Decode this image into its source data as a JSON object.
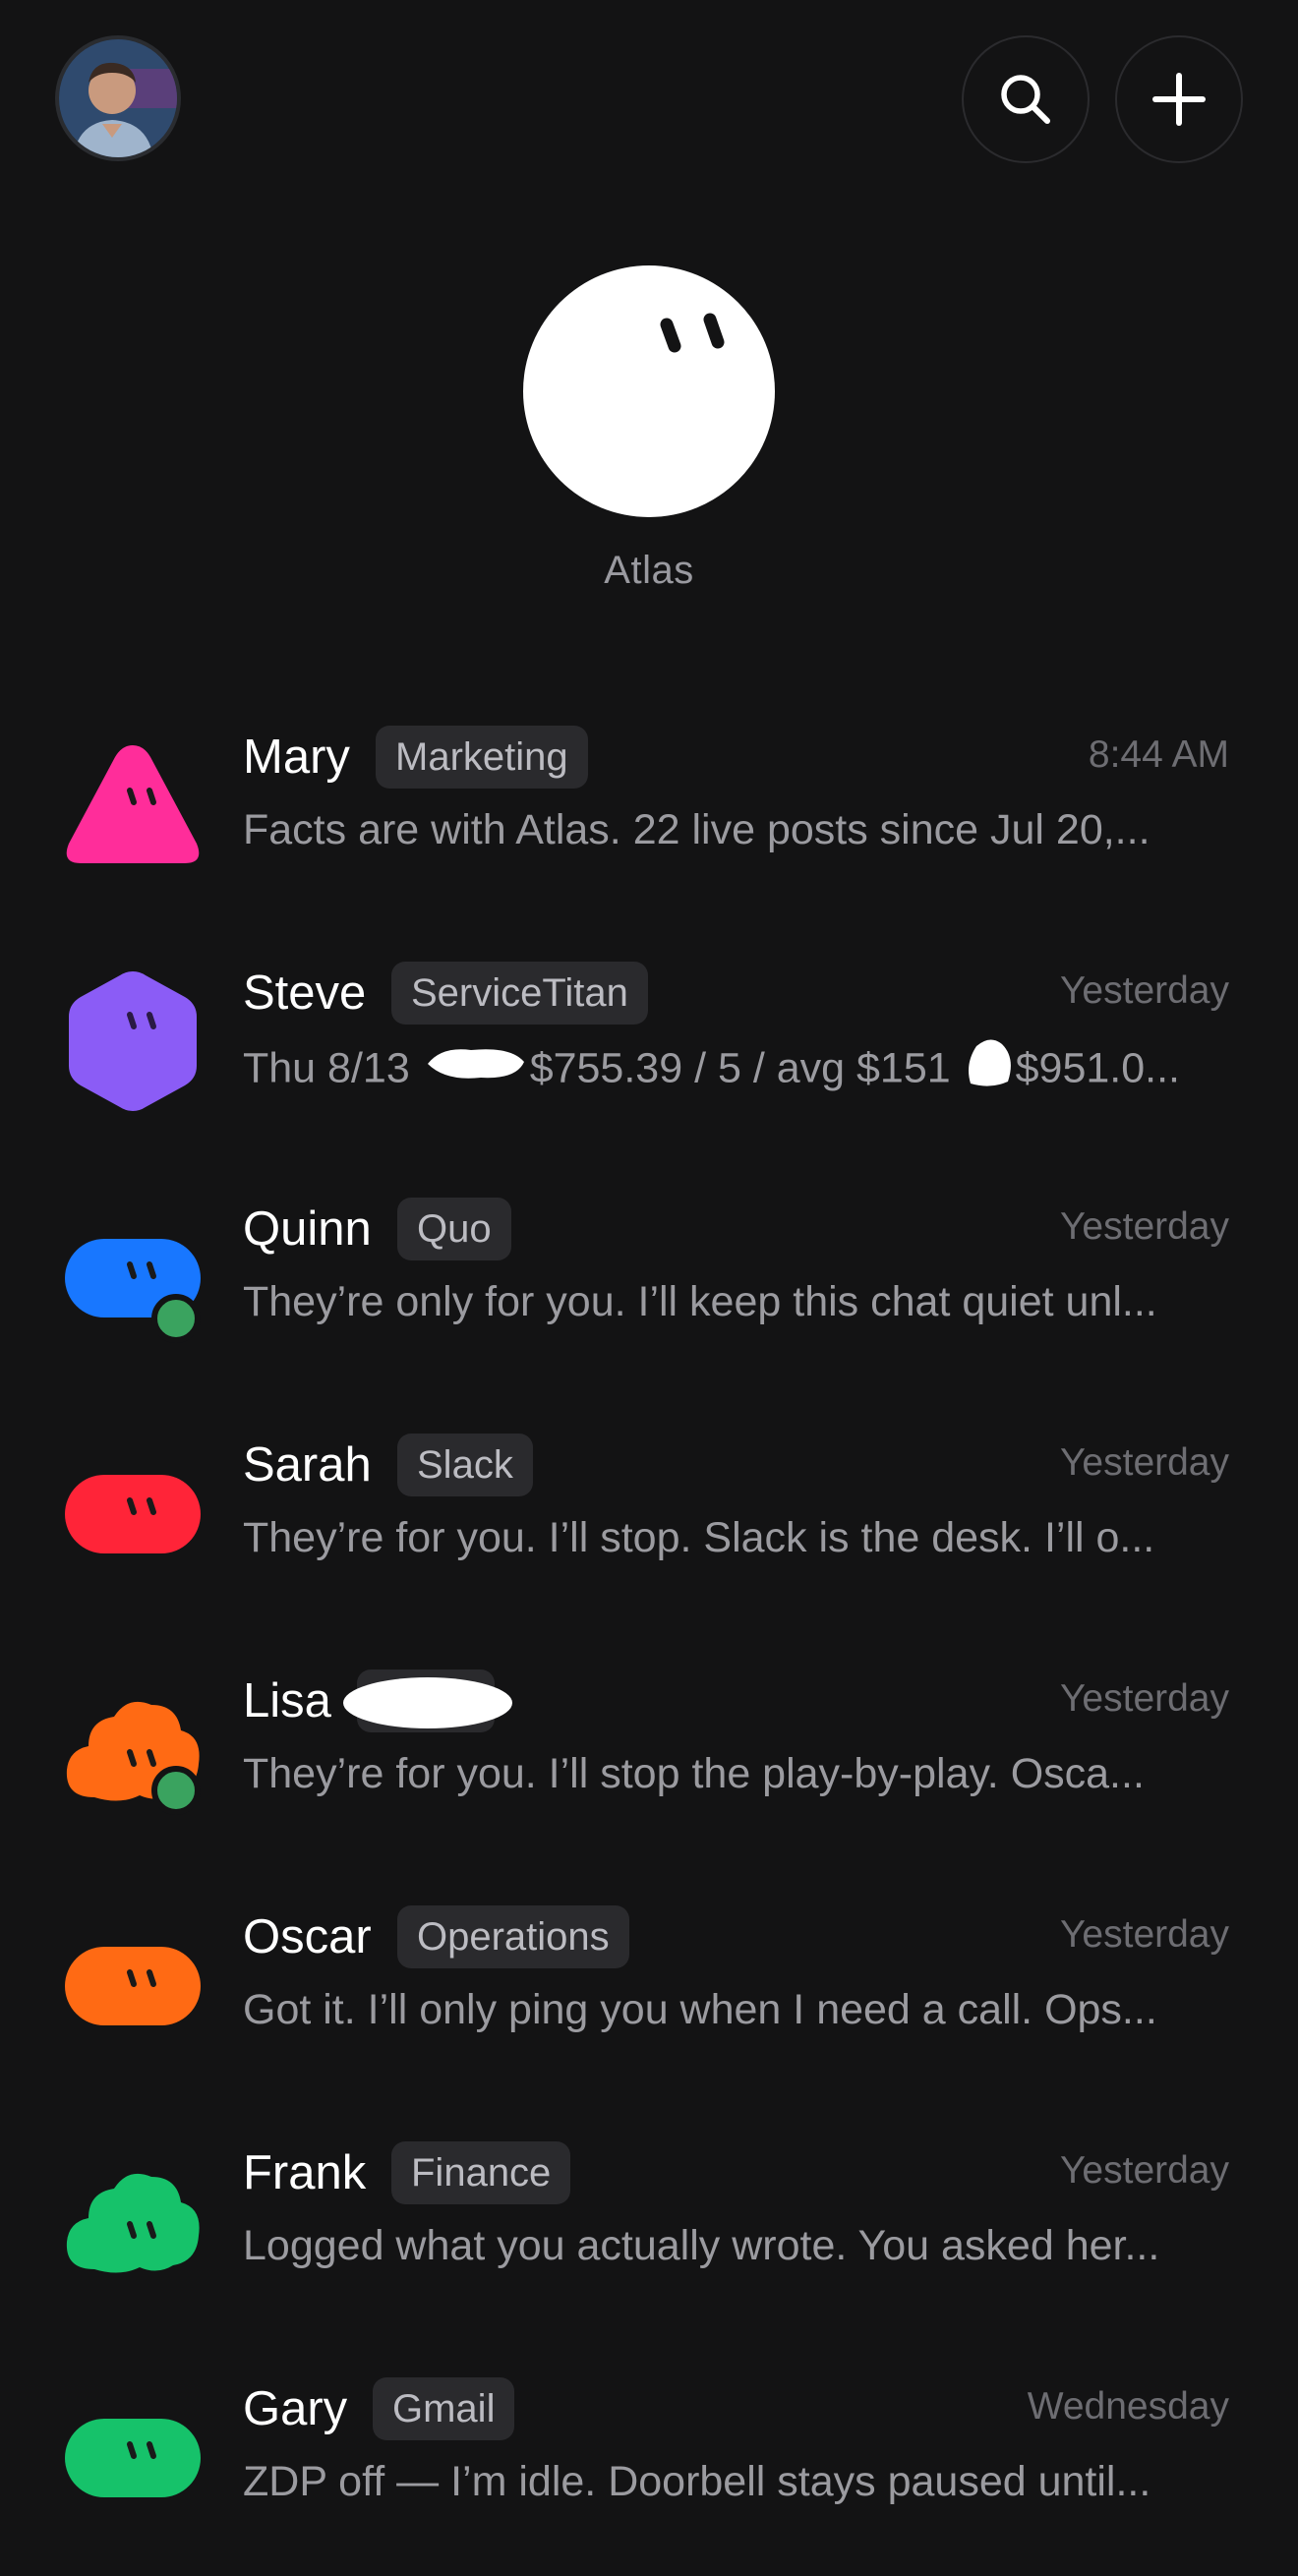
{
  "header": {
    "profile_avatar": "user-photo",
    "search_icon": "search-icon",
    "add_icon": "plus-icon"
  },
  "hero": {
    "name": "Atlas"
  },
  "conversations": [
    {
      "name": "Mary",
      "tag": "Marketing",
      "time": "8:44 AM",
      "preview": "Facts are with Atlas. 22 live posts since Jul 20,...",
      "color": "#ff2d9a",
      "shape": "triangle",
      "online": false
    },
    {
      "name": "Steve",
      "tag": "ServiceTitan",
      "time": "Yesterday",
      "preview_parts": [
        "Thu 8/13 ",
        "$755.39 / 5 / avg $151 ",
        "$951.0..."
      ],
      "color": "#8b5cf6",
      "shape": "hexagon",
      "online": false
    },
    {
      "name": "Quinn",
      "tag": "Quo",
      "time": "Yesterday",
      "preview": "They’re only for you. I’ll keep this chat quiet unl...",
      "color": "#1877ff",
      "shape": "blob",
      "online": true
    },
    {
      "name": "Sarah",
      "tag": "Slack",
      "time": "Yesterday",
      "preview": "They’re for you. I’ll stop. Slack is the desk. I’ll o...",
      "color": "#ff2438",
      "shape": "blob",
      "online": false
    },
    {
      "name": "Lisa",
      "tag": "",
      "time": "Yesterday",
      "preview": "They’re for you. I’ll stop the play-by-play. Osca...",
      "color": "#ff6a14",
      "shape": "cloud",
      "online": true
    },
    {
      "name": "Oscar",
      "tag": "Operations",
      "time": "Yesterday",
      "preview": "Got it. I’ll only ping you when I need a call. Ops...",
      "color": "#ff6a14",
      "shape": "blob",
      "online": false
    },
    {
      "name": "Frank",
      "tag": "Finance",
      "time": "Yesterday",
      "preview": "Logged what you actually wrote. You asked her...",
      "color": "#16c26a",
      "shape": "cloud",
      "online": false
    },
    {
      "name": "Gary",
      "tag": "Gmail",
      "time": "Wednesday",
      "preview": "ZDP off — I’m idle. Doorbell stays paused until...",
      "color": "#16c26a",
      "shape": "blob",
      "online": false
    }
  ]
}
